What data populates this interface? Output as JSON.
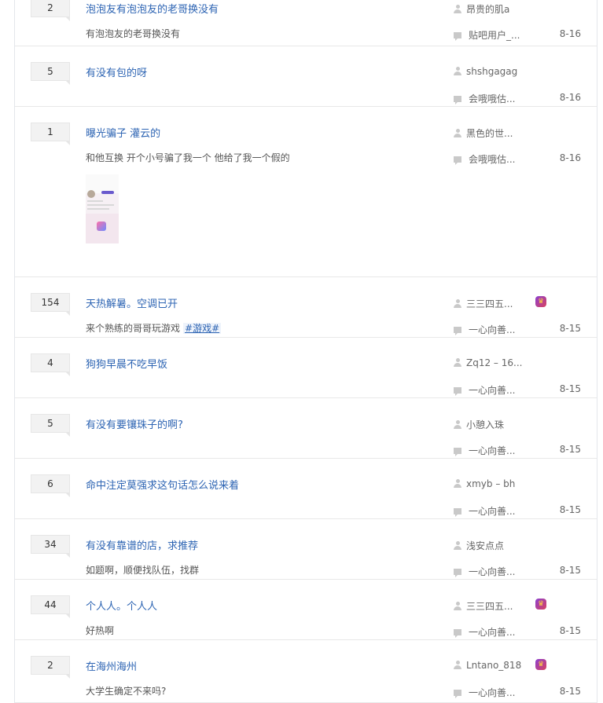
{
  "threads": [
    {
      "replies": "2",
      "title": "泡泡友有泡泡友的老哥换没有",
      "abstract": "有泡泡友的老哥换没有",
      "tag": "",
      "author": "昂贵的肌a",
      "badge": false,
      "last_reply": "贴吧用户_...",
      "date": "8-16",
      "image": false
    },
    {
      "replies": "5",
      "title": "有没有包的呀",
      "abstract": "",
      "tag": "",
      "author": "shshgagag",
      "badge": false,
      "last_reply": "会哦哦估...",
      "date": "8-16",
      "image": false
    },
    {
      "replies": "1",
      "title": "曝光骗子 灌云的",
      "abstract": "和他互换 开个小号骗了我一个 他给了我一个假的",
      "tag": "",
      "author": "黑色的世...",
      "badge": false,
      "last_reply": "会哦哦估...",
      "date": "8-16",
      "image": true
    },
    {
      "replies": "154",
      "title": "天热解暑。空调已开",
      "abstract": "来个熟练的哥哥玩游戏",
      "tag": "#游戏#",
      "author": "三三四五...",
      "badge": true,
      "last_reply": "一心向善...",
      "date": "8-15",
      "image": false
    },
    {
      "replies": "4",
      "title": "狗狗早晨不吃早饭",
      "abstract": "",
      "tag": "",
      "author": "Zq12 – 16...",
      "badge": false,
      "last_reply": "一心向善...",
      "date": "8-15",
      "image": false
    },
    {
      "replies": "5",
      "title": "有没有要镶珠子的啊?",
      "abstract": "",
      "tag": "",
      "author": "小憩入珠",
      "badge": false,
      "last_reply": "一心向善...",
      "date": "8-15",
      "image": false
    },
    {
      "replies": "6",
      "title": "命中注定莫强求这句话怎么说来着",
      "abstract": "",
      "tag": "",
      "author": "xmyb – bh",
      "badge": false,
      "last_reply": "一心向善...",
      "date": "8-15",
      "image": false
    },
    {
      "replies": "34",
      "title": "有没有靠谱的店，求推荐",
      "abstract": "如题啊，顺便找队伍，找群",
      "tag": "",
      "author": "浅安点点",
      "badge": false,
      "last_reply": "一心向善...",
      "date": "8-15",
      "image": false
    },
    {
      "replies": "44",
      "title": "个人人。个人人",
      "abstract": "好热啊",
      "tag": "",
      "author": "三三四五...",
      "badge": true,
      "last_reply": "一心向善...",
      "date": "8-15",
      "image": false
    },
    {
      "replies": "2",
      "title": "在海州海州",
      "abstract": "大学生确定不来吗?",
      "tag": "",
      "author": "Lntano_818",
      "badge": true,
      "last_reply": "一心向善...",
      "date": "8-15",
      "image": false
    }
  ],
  "icons": {
    "author": "user-icon",
    "last_reply": "comment-icon",
    "badge": "member-badge-icon"
  },
  "colors": {
    "title": "#2d64b3",
    "meta": "#666666",
    "divider": "#e8e8e8",
    "reply_box": "#f2f2f2"
  }
}
